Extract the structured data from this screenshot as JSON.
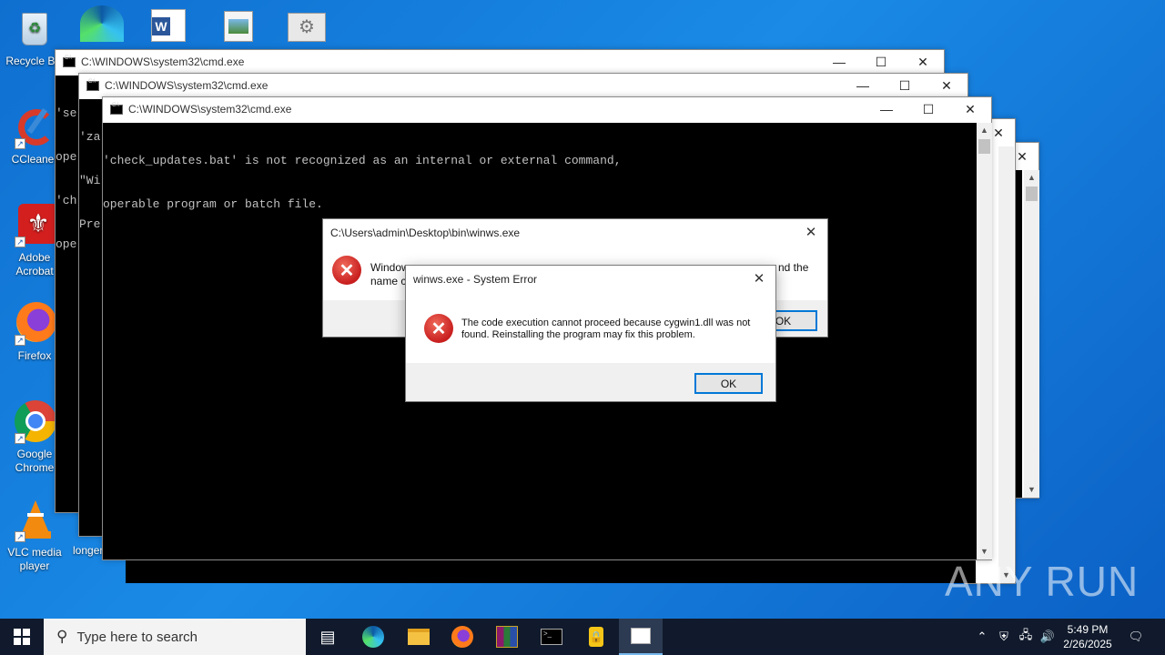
{
  "desktop": {
    "icons": [
      {
        "label": "Recycle Bin",
        "icon": "recycle-bin-icon"
      },
      {
        "label": "CCleaner",
        "icon": "ccleaner-icon"
      },
      {
        "label": "Adobe Acrobat",
        "icon": "acrobat-icon"
      },
      {
        "label": "Firefox",
        "icon": "firefox-icon"
      },
      {
        "label": "Google Chrome",
        "icon": "chrome-icon"
      },
      {
        "label": "VLC media player",
        "icon": "vlc-icon"
      },
      {
        "label": "longer",
        "icon": "file-icon"
      }
    ],
    "top_row_icons": [
      "edge-icon",
      "word-icon",
      "image-file-icon",
      "settings-file-icon"
    ]
  },
  "console_windows": [
    {
      "title": "C:\\WINDOWS\\system32\\cmd.exe",
      "lines": [
        "'se",
        "ope",
        "'ch",
        "ope"
      ]
    },
    {
      "title": "C:\\WINDOWS\\system32\\cmd.exe",
      "lines": [
        "'za",
        "\"Wi",
        "Pre"
      ]
    },
    {
      "title": "C:\\WINDOWS\\system32\\cmd.exe",
      "lines": [
        "'check_updates.bat' is not recognized as an internal or external command,",
        "operable program or batch file."
      ]
    }
  ],
  "window_controls": {
    "minimize": "—",
    "maximize": "☐",
    "close": "✕"
  },
  "dialog_back": {
    "title": "C:\\Users\\admin\\Desktop\\bin\\winws.exe",
    "message_left": "Window",
    "message_right": "nd the",
    "message_line2": "name c",
    "ok": "OK"
  },
  "dialog_front": {
    "title": "winws.exe - System Error",
    "message": "The code execution cannot proceed because cygwin1.dll was not found. Reinstalling the program may fix this problem.",
    "ok": "OK"
  },
  "taskbar": {
    "search_placeholder": "Type here to search",
    "time": "5:49 PM",
    "date": "2/26/2025"
  },
  "watermark": "ANY RUN",
  "colors": {
    "desktop": "#1a8ae6",
    "taskbar": "#101a2c",
    "error_red": "#c81e1e",
    "accent": "#0078d7"
  }
}
